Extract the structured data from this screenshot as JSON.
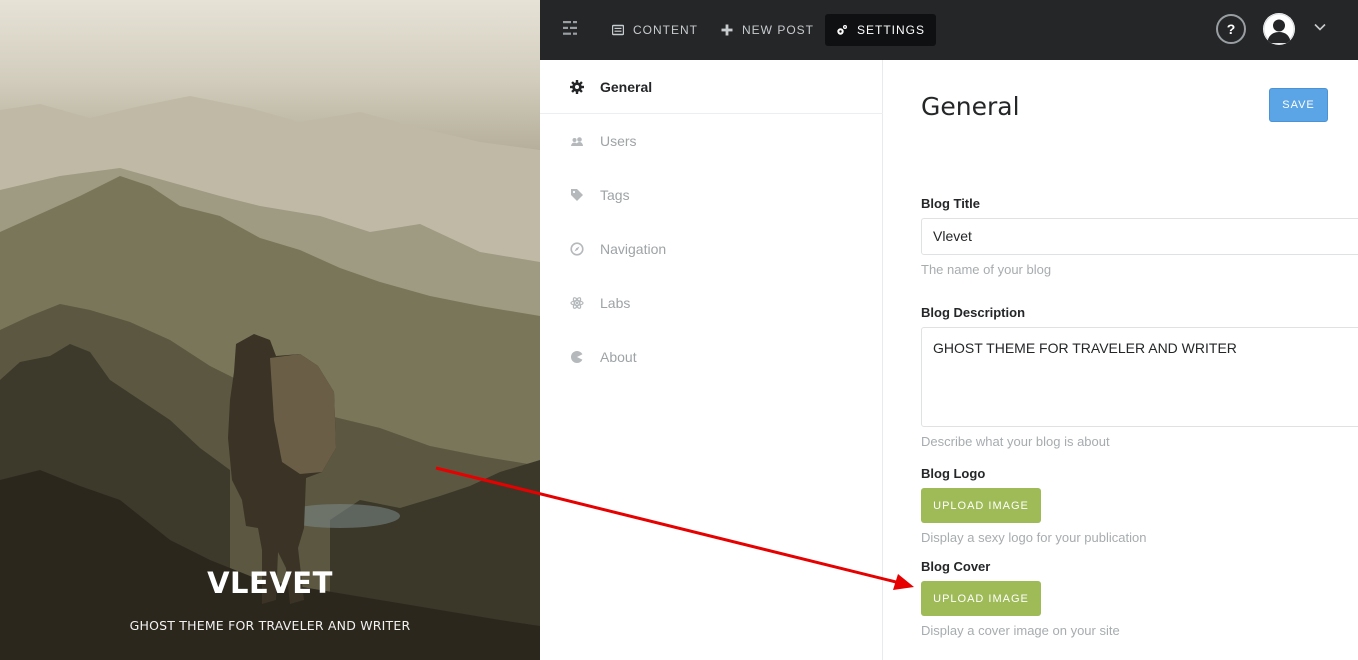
{
  "hero": {
    "title": "VLEVET",
    "subtitle": "GHOST THEME FOR TRAVELER AND WRITER"
  },
  "topnav": {
    "menu_icon": "menu-icon",
    "items": [
      {
        "label": "CONTENT",
        "icon": "content-icon"
      },
      {
        "label": "NEW POST",
        "icon": "plus-icon"
      },
      {
        "label": "SETTINGS",
        "icon": "gears-icon"
      }
    ],
    "help_label": "?"
  },
  "sidebar": {
    "items": [
      {
        "label": "General",
        "icon": "gear-icon"
      },
      {
        "label": "Users",
        "icon": "users-icon"
      },
      {
        "label": "Tags",
        "icon": "tag-icon"
      },
      {
        "label": "Navigation",
        "icon": "compass-icon"
      },
      {
        "label": "Labs",
        "icon": "atom-icon"
      },
      {
        "label": "About",
        "icon": "ghost-icon"
      }
    ]
  },
  "main": {
    "title": "General",
    "save_label": "SAVE",
    "blog_title": {
      "label": "Blog Title",
      "value": "Vlevet",
      "hint": "The name of your blog"
    },
    "blog_description": {
      "label": "Blog Description",
      "value": "GHOST THEME FOR TRAVELER AND WRITER",
      "hint": "Describe what your blog is about"
    },
    "blog_logo": {
      "label": "Blog Logo",
      "button": "UPLOAD IMAGE",
      "hint": "Display a sexy logo for your publication"
    },
    "blog_cover": {
      "label": "Blog Cover",
      "button": "UPLOAD IMAGE",
      "hint": "Display a cover image on your site"
    }
  },
  "colors": {
    "topbar": "#242628",
    "save_button": "#5ba4e5",
    "upload_button": "#9fbb58",
    "annotation_arrow": "#e60000"
  }
}
